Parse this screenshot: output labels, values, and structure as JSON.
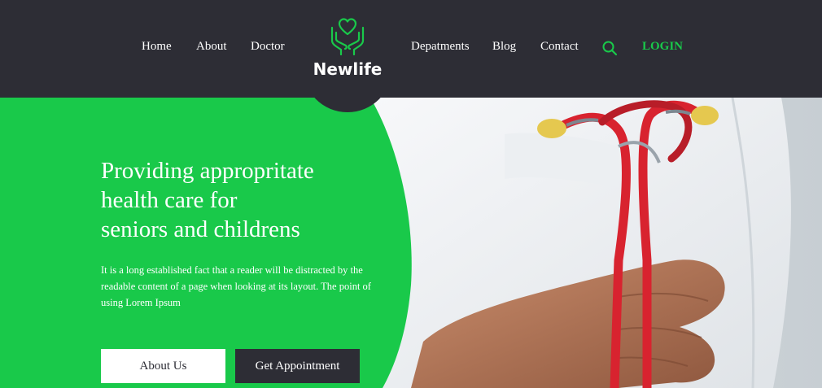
{
  "brand": {
    "name": "Newlife",
    "icon": "heart-hands-icon",
    "accent": "#19c94a"
  },
  "nav": {
    "home": "Home",
    "about": "About",
    "doctor": "Doctor",
    "departments": "Depatments",
    "blog": "Blog",
    "contact": "Contact",
    "login": "LOGIN"
  },
  "hero": {
    "title_line1": "Providing appropritate",
    "title_line2": "health care for",
    "title_line3": "seniors and childrens",
    "description": "It is a long established fact that a reader will be distracted by the readable content of a page when looking at its layout. The point of using Lorem Ipsum",
    "button_about": "About Us",
    "button_appointment": "Get Appointment"
  },
  "colors": {
    "header_bg": "#2d2d35",
    "green": "#19c94a",
    "white": "#ffffff"
  }
}
